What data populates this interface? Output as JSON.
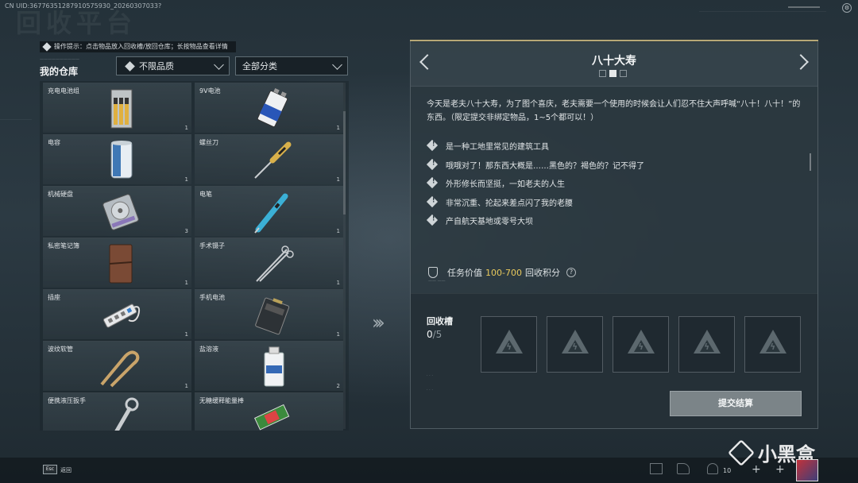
{
  "session": {
    "uid_text": "CN UID:3677635128791057593​0_20260307033?"
  },
  "page": {
    "background_title": "回收平台"
  },
  "hint": {
    "text": "操作提示：点击物品放入回收槽/放回仓库；长按物品查看详情"
  },
  "warehouse": {
    "title": "我的仓库",
    "quality_filter": "不限品质",
    "category_filter": "全部分类",
    "items": [
      {
        "name": "充电电池组",
        "count": "1",
        "icon": "battery-pack-icon"
      },
      {
        "name": "9V电池",
        "count": "1",
        "icon": "9v-battery-icon"
      },
      {
        "name": "电容",
        "count": "1",
        "icon": "capacitor-icon"
      },
      {
        "name": "螺丝刀",
        "count": "1",
        "icon": "screwdriver-icon"
      },
      {
        "name": "机械硬盘",
        "count": "3",
        "icon": "hard-disk-icon"
      },
      {
        "name": "电笔",
        "count": "1",
        "icon": "test-pen-icon"
      },
      {
        "name": "私密笔记簿",
        "count": "1",
        "icon": "notebook-icon"
      },
      {
        "name": "手术镊子",
        "count": "1",
        "icon": "forceps-icon"
      },
      {
        "name": "插座",
        "count": "1",
        "icon": "power-strip-icon"
      },
      {
        "name": "手机电池",
        "count": "1",
        "icon": "phone-battery-icon"
      },
      {
        "name": "波纹软管",
        "count": "1",
        "icon": "hose-icon"
      },
      {
        "name": "盐溶液",
        "count": "2",
        "icon": "saline-icon"
      },
      {
        "name": "便携液压扳手",
        "count": "",
        "icon": "wrench-icon"
      },
      {
        "name": "无糖缓释能量棒",
        "count": "",
        "icon": "energy-bar-icon"
      }
    ]
  },
  "task": {
    "title": "八十大寿",
    "description": "今天是老夫八十大寿，为了图个喜庆，老夫需要一个使用的时候会让人们忍不住大声呼喊“八十！八十！”的东西。（限定提交非绑定物品，1~5个都可以！）",
    "clues": [
      "是一种工地里常见的建筑工具",
      "哦哦对了！那东西大概是……黑色的？褐色的？记不得了",
      "外形修长而坚挺，一如老夫的人生",
      "非常沉重、抡起来差点闪了我的老腰",
      "产自航天基地或零号大坝"
    ],
    "value_label": "任务价值",
    "value_range": "100-700",
    "value_unit": "回收积分",
    "help_symbol": "?",
    "page_dots": 3,
    "active_page": 2
  },
  "recycle": {
    "title": "回收槽",
    "filled": "0",
    "capacity": "/5",
    "slots": 5,
    "submit_label": "提交结算"
  },
  "footer": {
    "esc_key": "Esc",
    "back_label": "返回",
    "friends_count": "10",
    "watermark": "小黑盒"
  },
  "colors": {
    "accent_gold": "#e8c95c",
    "panel_border_gold": "#b7a876"
  }
}
